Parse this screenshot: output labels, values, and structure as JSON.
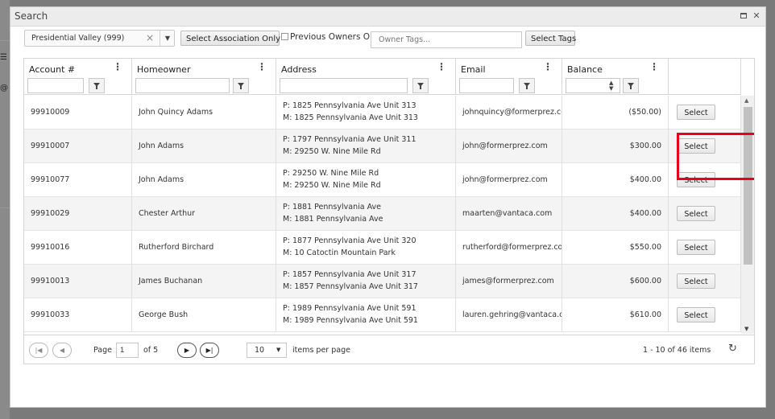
{
  "dialog": {
    "title": "Search"
  },
  "toolbar": {
    "association": "Presidential Valley (999)",
    "select_association_label": "Select Association Only",
    "previous_owners_label": "Previous Owners Only",
    "owner_tags_placeholder": "Owner Tags...",
    "select_tags_label": "Select Tags"
  },
  "grid": {
    "columns": [
      "Account #",
      "Homeowner",
      "Address",
      "Email",
      "Balance"
    ],
    "select_label": "Select",
    "rows": [
      {
        "account": "99910009",
        "homeowner": "John Quincy Adams",
        "address_p": "P: 1825 Pennsylvania Ave Unit 313",
        "address_m": "M: 1825 Pennsylvania Ave Unit 313",
        "email": "johnquincy@formerprez.com",
        "balance": "($50.00)"
      },
      {
        "account": "99910007",
        "homeowner": "John Adams",
        "address_p": "P: 1797 Pennsylvania Ave Unit 311",
        "address_m": "M: 29250 W. Nine Mile Rd",
        "email": "john@formerprez.com",
        "balance": "$300.00"
      },
      {
        "account": "99910077",
        "homeowner": "John Adams",
        "address_p": "P: 29250 W. Nine Mile Rd",
        "address_m": "M: 29250 W. Nine Mile Rd",
        "email": "john@formerprez.com",
        "balance": "$400.00"
      },
      {
        "account": "99910029",
        "homeowner": "Chester Arthur",
        "address_p": "P: 1881 Pennsylvania Ave",
        "address_m": "M: 1881 Pennsylvania Ave",
        "email": "maarten@vantaca.com",
        "balance": "$400.00"
      },
      {
        "account": "99910016",
        "homeowner": "Rutherford Birchard",
        "address_p": "P: 1877 Pennsylvania Ave Unit 320",
        "address_m": "M: 10 Catoctin Mountain Park",
        "email": "rutherford@formerprez.com",
        "balance": "$550.00"
      },
      {
        "account": "99910013",
        "homeowner": "James Buchanan",
        "address_p": "P: 1857 Pennsylvania Ave Unit 317",
        "address_m": "M: 1857 Pennsylvania Ave Unit 317",
        "email": "james@formerprez.com",
        "balance": "$600.00"
      },
      {
        "account": "99910033",
        "homeowner": "George Bush",
        "address_p": "P: 1989 Pennsylvania Ave Unit 591",
        "address_m": "M: 1989 Pennsylvania Ave Unit 591",
        "email": "lauren.gehring@vantaca.com",
        "balance": "$610.00"
      }
    ]
  },
  "pager": {
    "page_label": "Page",
    "current_page": "1",
    "of_label": "of 5",
    "page_size": "10",
    "items_per_page_label": "items per page",
    "summary": "1 - 10 of 46 items"
  },
  "colors": {
    "highlight": "#e8001c",
    "alt_row": "#f4f4f4"
  }
}
